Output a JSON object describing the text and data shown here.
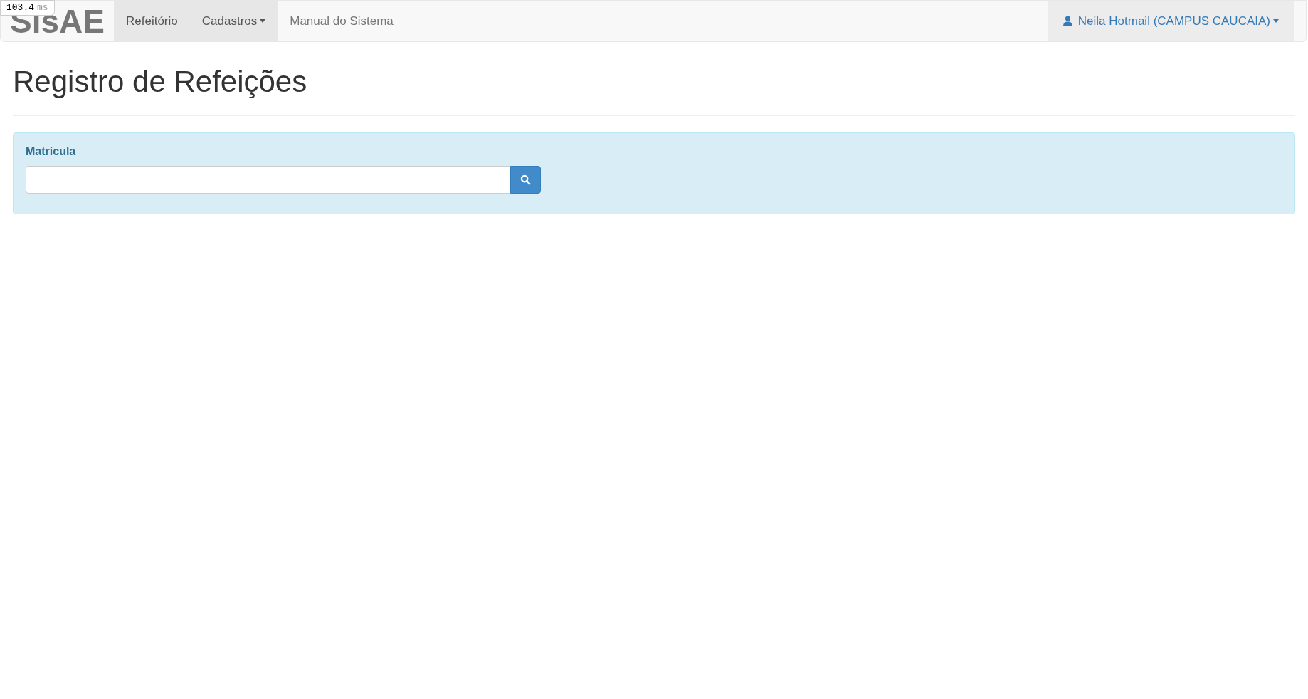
{
  "debug_badge": {
    "value": "103.4",
    "unit": "ms"
  },
  "navbar": {
    "brand": "SisAE",
    "items": [
      {
        "label": "Refeitório",
        "selected": true,
        "dropdown": false
      },
      {
        "label": "Cadastros",
        "selected": true,
        "dropdown": true
      },
      {
        "label": "Manual do Sistema",
        "selected": false,
        "dropdown": false
      }
    ],
    "user_menu": {
      "label": "Neila Hotmail (CAMPUS CAUCAIA)",
      "selected": true
    }
  },
  "page_title": "Registro de Refeições",
  "search_panel": {
    "label": "Matrícula"
  }
}
